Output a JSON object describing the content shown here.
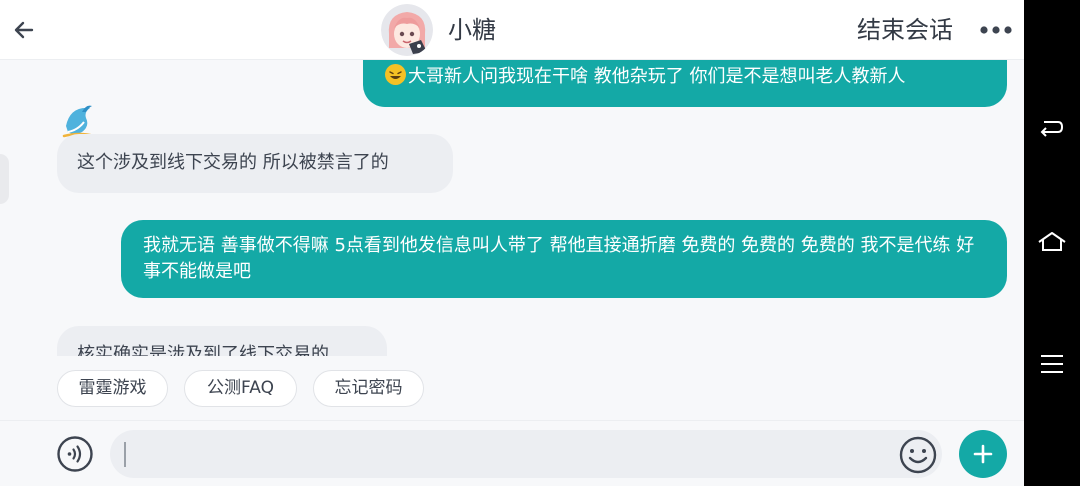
{
  "header": {
    "agent_name": "小糖",
    "end_chat_label": "结束会话",
    "icons": {
      "back": "arrow-left-icon",
      "more": "more-dots-icon",
      "avatar": "anime-girl-avatar"
    }
  },
  "messages": [
    {
      "direction": "out",
      "text": "大哥新人问我现在干啥 教他杂玩了 你们是不是想叫老人教新人",
      "emoji": "rofl-emoji"
    },
    {
      "direction": "in",
      "text": "这个涉及到线下交易的 所以被禁言了的"
    },
    {
      "direction": "out",
      "text": "我就无语 善事做不得嘛 5点看到他发信息叫人带了 帮他直接通折磨 免费的 免费的 免费的 我不是代练 好事不能做是吧"
    },
    {
      "direction": "in",
      "text": "核实确实是涉及到了线下交易的"
    }
  ],
  "quick_replies": [
    "雷霆游戏",
    "公测FAQ",
    "忘记密码"
  ],
  "input": {
    "value": "",
    "placeholder": ""
  },
  "colors": {
    "accent": "#14a9a6",
    "incoming_bubble": "#eceef2",
    "background": "#f7f8fa"
  },
  "nav": {
    "icons": [
      "nav-back-icon",
      "nav-home-icon",
      "nav-menu-icon"
    ]
  }
}
